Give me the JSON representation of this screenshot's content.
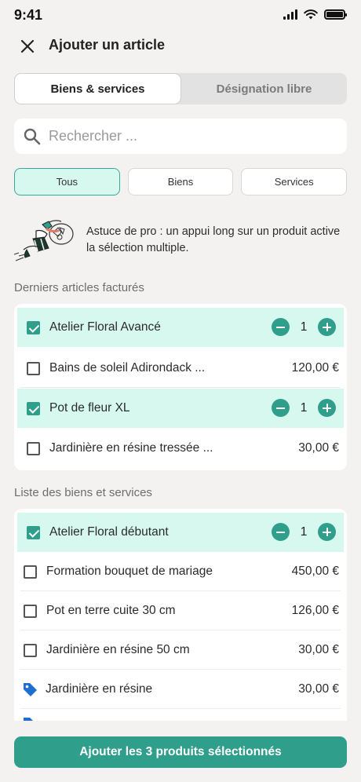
{
  "status": {
    "time": "9:41"
  },
  "header": {
    "title": "Ajouter un article"
  },
  "segments": {
    "left": "Biens & services",
    "right": "Désignation libre"
  },
  "search": {
    "placeholder": "Rechercher ..."
  },
  "filters": {
    "all": "Tous",
    "goods": "Biens",
    "services": "Services"
  },
  "tip": {
    "text": "Astuce de pro : un appui long sur un produit active la sélection multiple."
  },
  "recent": {
    "title": "Derniers articles facturés",
    "items": [
      {
        "label": "Atelier Floral Avancé",
        "qty": "1",
        "price": ""
      },
      {
        "label": "Bains de soleil Adirondack ...",
        "qty": "",
        "price": "120,00 €"
      },
      {
        "label": "Pot de fleur XL",
        "qty": "1",
        "price": ""
      },
      {
        "label": "Jardinière en résine tressée ...",
        "qty": "",
        "price": "30,00 €"
      }
    ]
  },
  "catalog": {
    "title": "Liste des biens et services",
    "items": [
      {
        "label": "Atelier Floral débutant",
        "qty": "1",
        "price": ""
      },
      {
        "label": "Formation bouquet de mariage",
        "qty": "",
        "price": "450,00 €"
      },
      {
        "label": "Pot en terre cuite 30 cm",
        "qty": "",
        "price": "126,00 €"
      },
      {
        "label": "Jardinière en résine 50 cm",
        "qty": "",
        "price": "30,00 €"
      },
      {
        "label": "Jardinière en résine",
        "qty": "",
        "price": "30,00 €"
      }
    ]
  },
  "cta": {
    "label": "Ajouter les 3 produits sélectionnés"
  },
  "colors": {
    "accent": "#2f9e8b",
    "selected_bg": "#d6f8ef",
    "tag_icon": "#1f6fd1"
  }
}
